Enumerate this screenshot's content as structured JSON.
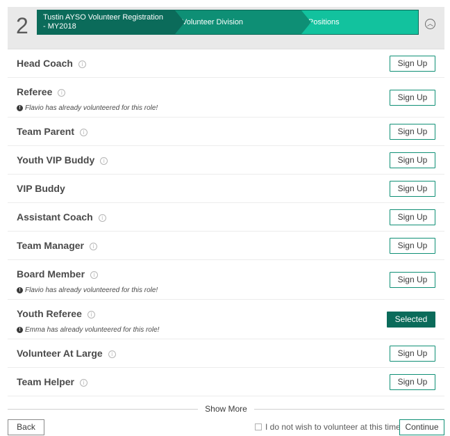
{
  "header": {
    "step_number": "2",
    "breadcrumbs": [
      "Tustin AYSO Volunteer Registration - MY2018",
      "Volunteer Division",
      "Positions"
    ],
    "collapse_icon": "chevron-up-circle-icon"
  },
  "roles": [
    {
      "title": "Head Coach",
      "info": true,
      "note": "",
      "button": "Sign Up"
    },
    {
      "title": "Referee",
      "info": true,
      "note": "Flavio has already volunteered for this role!",
      "button": "Sign Up"
    },
    {
      "title": "Team Parent",
      "info": true,
      "note": "",
      "button": "Sign Up"
    },
    {
      "title": "Youth VIP Buddy",
      "info": true,
      "note": "",
      "button": "Sign Up"
    },
    {
      "title": "VIP Buddy",
      "info": false,
      "note": "",
      "button": "Sign Up"
    },
    {
      "title": "Assistant Coach",
      "info": true,
      "note": "",
      "button": "Sign Up"
    },
    {
      "title": "Team Manager",
      "info": true,
      "note": "",
      "button": "Sign Up"
    },
    {
      "title": "Board Member",
      "info": true,
      "note": "Flavio has already volunteered for this role!",
      "button": "Sign Up"
    },
    {
      "title": "Youth Referee",
      "info": true,
      "note": "Emma has already volunteered for this role!",
      "button": "Selected"
    },
    {
      "title": "Volunteer At Large",
      "info": true,
      "note": "",
      "button": "Sign Up"
    },
    {
      "title": "Team Helper",
      "info": true,
      "note": "",
      "button": "Sign Up"
    }
  ],
  "show_more": "Show More",
  "footer": {
    "back_label": "Back",
    "optout_label": "I do not wish to volunteer at this time",
    "continue_label": "Continue"
  },
  "colors": {
    "accent_dark": "#0b6b5a",
    "accent_mid": "#0e8f75",
    "accent_light": "#12c29e"
  }
}
